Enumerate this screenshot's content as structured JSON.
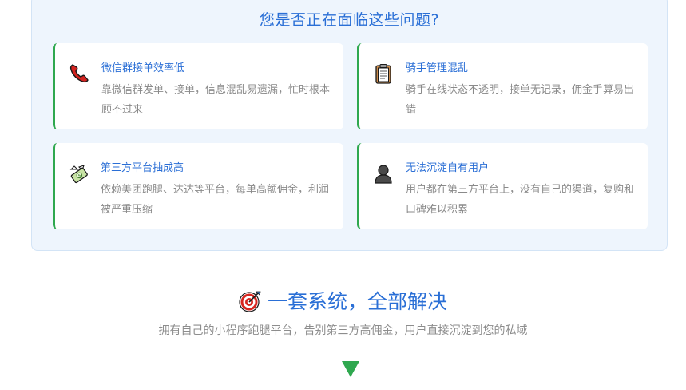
{
  "problems": {
    "title": "您是否正在面临这些问题?",
    "cards": [
      {
        "icon": "telephone-receiver-icon",
        "title": "微信群接单效率低",
        "desc": "靠微信群发单、接单，信息混乱易遗漏，忙时根本顾不过来"
      },
      {
        "icon": "clipboard-icon",
        "title": "骑手管理混乱",
        "desc": "骑手在线状态不透明，接单无记录，佣金手算易出错"
      },
      {
        "icon": "money-with-wings-icon",
        "title": "第三方平台抽成高",
        "desc": "依赖美团跑腿、达达等平台，每单高额佣金，利润被严重压缩"
      },
      {
        "icon": "user-silhouette-icon",
        "title": "无法沉淀自有用户",
        "desc": "用户都在第三方平台上，没有自己的渠道，复购和口碑难以积累"
      }
    ]
  },
  "solution": {
    "icon": "direct-hit-target-icon",
    "title": "一套系统，全部解决",
    "subtitle": "拥有自己的小程序跑腿平台，告别第三方高佣金，用户直接沉淀到您的私域"
  },
  "colors": {
    "accent": "#2a6fd6",
    "card_border": "#2fa84f",
    "section_bg": "#eef5fd",
    "arrow": "#2fa84f"
  }
}
